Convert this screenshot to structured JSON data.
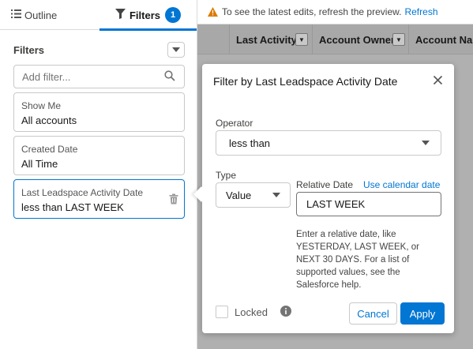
{
  "tabs": {
    "outline": {
      "icon": "list-icon",
      "label": "Outline"
    },
    "filters": {
      "icon": "filter-icon",
      "label": "Filters",
      "badge": "1"
    }
  },
  "filters_panel": {
    "title": "Filters",
    "add_filter_placeholder": "Add filter...",
    "cards": [
      {
        "label": "Show Me",
        "value": "All accounts"
      },
      {
        "label": "Created Date",
        "value": "All Time"
      },
      {
        "label": "Last Leadspace Activity Date",
        "value": "less than LAST WEEK"
      }
    ]
  },
  "banner": {
    "text": "To see the latest edits, refresh the preview.",
    "link": "Refresh"
  },
  "grid": {
    "columns": [
      "Last Activity",
      "Account Owner",
      "Account Name"
    ]
  },
  "popover": {
    "title": "Filter by Last Leadspace Activity Date",
    "operator_label": "Operator",
    "operator_value": "less than",
    "type_label": "Type",
    "type_value": "Value",
    "relative_date_label": "Relative Date",
    "calendar_link": "Use calendar date",
    "relative_date_value": "LAST WEEK",
    "help_text": "Enter a relative date, like YESTERDAY, LAST WEEK, or NEXT 30 DAYS. For a list of supported values, see the Salesforce help.",
    "locked_label": "Locked",
    "cancel_label": "Cancel",
    "apply_label": "Apply"
  },
  "colors": {
    "brand": "#0176d3",
    "warning": "#dd7a01",
    "backdrop": "#b0b0b0"
  }
}
